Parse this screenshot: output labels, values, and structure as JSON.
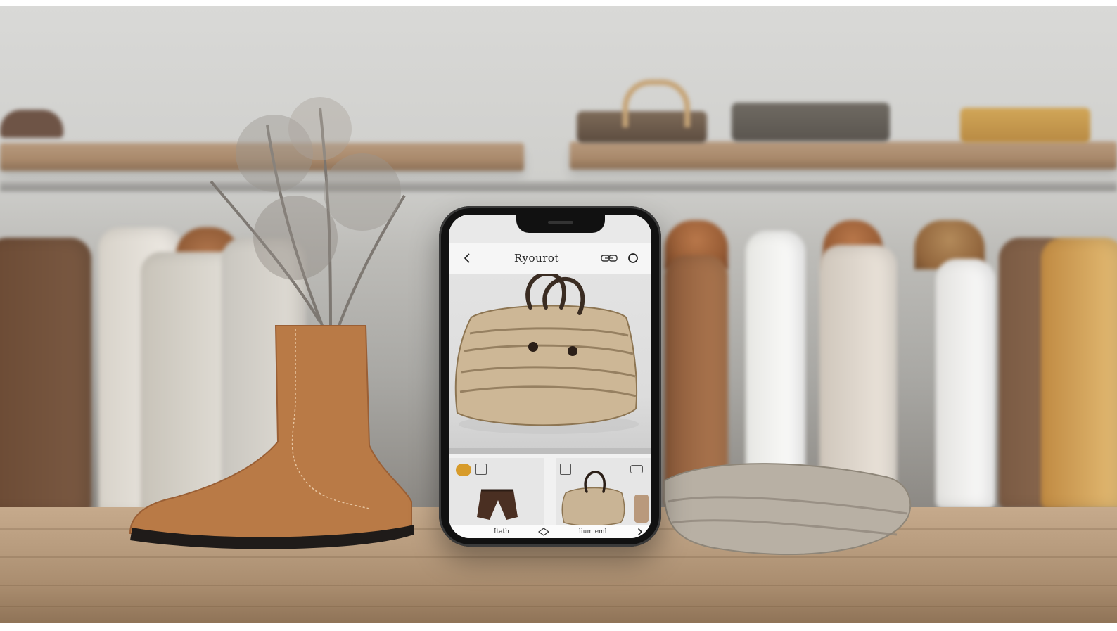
{
  "app": {
    "title": "Ryourot",
    "bottom_nav": {
      "left_label": "Itath",
      "right_label": "lium eml"
    }
  },
  "colors": {
    "screen_bg": "#f3f3f3",
    "accent_badge": "#d79b2a"
  },
  "icons": {
    "back": "chevron-left-icon",
    "share": "link-icon",
    "profile": "circle-icon",
    "bag_badge": "badge-icon",
    "thumb_left_badge": "square-outline-icon",
    "thumb_right_badge_left": "square-outline-icon",
    "thumb_right_badge_right": "rounded-rect-icon",
    "bottom_middle": "diamond-icon",
    "bottom_right": "chevron-right-icon"
  }
}
